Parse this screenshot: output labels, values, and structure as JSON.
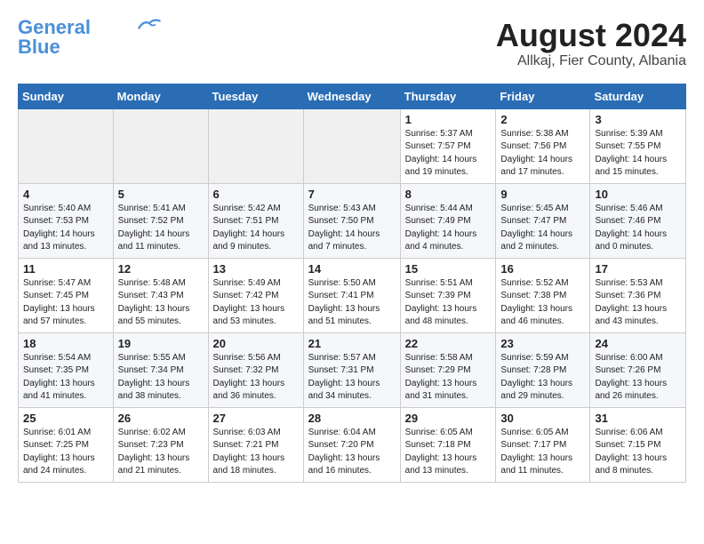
{
  "header": {
    "logo_line1": "General",
    "logo_line2": "Blue",
    "month": "August 2024",
    "location": "Allkaj, Fier County, Albania"
  },
  "weekdays": [
    "Sunday",
    "Monday",
    "Tuesday",
    "Wednesday",
    "Thursday",
    "Friday",
    "Saturday"
  ],
  "weeks": [
    [
      {
        "day": "",
        "detail": ""
      },
      {
        "day": "",
        "detail": ""
      },
      {
        "day": "",
        "detail": ""
      },
      {
        "day": "",
        "detail": ""
      },
      {
        "day": "1",
        "detail": "Sunrise: 5:37 AM\nSunset: 7:57 PM\nDaylight: 14 hours\nand 19 minutes."
      },
      {
        "day": "2",
        "detail": "Sunrise: 5:38 AM\nSunset: 7:56 PM\nDaylight: 14 hours\nand 17 minutes."
      },
      {
        "day": "3",
        "detail": "Sunrise: 5:39 AM\nSunset: 7:55 PM\nDaylight: 14 hours\nand 15 minutes."
      }
    ],
    [
      {
        "day": "4",
        "detail": "Sunrise: 5:40 AM\nSunset: 7:53 PM\nDaylight: 14 hours\nand 13 minutes."
      },
      {
        "day": "5",
        "detail": "Sunrise: 5:41 AM\nSunset: 7:52 PM\nDaylight: 14 hours\nand 11 minutes."
      },
      {
        "day": "6",
        "detail": "Sunrise: 5:42 AM\nSunset: 7:51 PM\nDaylight: 14 hours\nand 9 minutes."
      },
      {
        "day": "7",
        "detail": "Sunrise: 5:43 AM\nSunset: 7:50 PM\nDaylight: 14 hours\nand 7 minutes."
      },
      {
        "day": "8",
        "detail": "Sunrise: 5:44 AM\nSunset: 7:49 PM\nDaylight: 14 hours\nand 4 minutes."
      },
      {
        "day": "9",
        "detail": "Sunrise: 5:45 AM\nSunset: 7:47 PM\nDaylight: 14 hours\nand 2 minutes."
      },
      {
        "day": "10",
        "detail": "Sunrise: 5:46 AM\nSunset: 7:46 PM\nDaylight: 14 hours\nand 0 minutes."
      }
    ],
    [
      {
        "day": "11",
        "detail": "Sunrise: 5:47 AM\nSunset: 7:45 PM\nDaylight: 13 hours\nand 57 minutes."
      },
      {
        "day": "12",
        "detail": "Sunrise: 5:48 AM\nSunset: 7:43 PM\nDaylight: 13 hours\nand 55 minutes."
      },
      {
        "day": "13",
        "detail": "Sunrise: 5:49 AM\nSunset: 7:42 PM\nDaylight: 13 hours\nand 53 minutes."
      },
      {
        "day": "14",
        "detail": "Sunrise: 5:50 AM\nSunset: 7:41 PM\nDaylight: 13 hours\nand 51 minutes."
      },
      {
        "day": "15",
        "detail": "Sunrise: 5:51 AM\nSunset: 7:39 PM\nDaylight: 13 hours\nand 48 minutes."
      },
      {
        "day": "16",
        "detail": "Sunrise: 5:52 AM\nSunset: 7:38 PM\nDaylight: 13 hours\nand 46 minutes."
      },
      {
        "day": "17",
        "detail": "Sunrise: 5:53 AM\nSunset: 7:36 PM\nDaylight: 13 hours\nand 43 minutes."
      }
    ],
    [
      {
        "day": "18",
        "detail": "Sunrise: 5:54 AM\nSunset: 7:35 PM\nDaylight: 13 hours\nand 41 minutes."
      },
      {
        "day": "19",
        "detail": "Sunrise: 5:55 AM\nSunset: 7:34 PM\nDaylight: 13 hours\nand 38 minutes."
      },
      {
        "day": "20",
        "detail": "Sunrise: 5:56 AM\nSunset: 7:32 PM\nDaylight: 13 hours\nand 36 minutes."
      },
      {
        "day": "21",
        "detail": "Sunrise: 5:57 AM\nSunset: 7:31 PM\nDaylight: 13 hours\nand 34 minutes."
      },
      {
        "day": "22",
        "detail": "Sunrise: 5:58 AM\nSunset: 7:29 PM\nDaylight: 13 hours\nand 31 minutes."
      },
      {
        "day": "23",
        "detail": "Sunrise: 5:59 AM\nSunset: 7:28 PM\nDaylight: 13 hours\nand 29 minutes."
      },
      {
        "day": "24",
        "detail": "Sunrise: 6:00 AM\nSunset: 7:26 PM\nDaylight: 13 hours\nand 26 minutes."
      }
    ],
    [
      {
        "day": "25",
        "detail": "Sunrise: 6:01 AM\nSunset: 7:25 PM\nDaylight: 13 hours\nand 24 minutes."
      },
      {
        "day": "26",
        "detail": "Sunrise: 6:02 AM\nSunset: 7:23 PM\nDaylight: 13 hours\nand 21 minutes."
      },
      {
        "day": "27",
        "detail": "Sunrise: 6:03 AM\nSunset: 7:21 PM\nDaylight: 13 hours\nand 18 minutes."
      },
      {
        "day": "28",
        "detail": "Sunrise: 6:04 AM\nSunset: 7:20 PM\nDaylight: 13 hours\nand 16 minutes."
      },
      {
        "day": "29",
        "detail": "Sunrise: 6:05 AM\nSunset: 7:18 PM\nDaylight: 13 hours\nand 13 minutes."
      },
      {
        "day": "30",
        "detail": "Sunrise: 6:05 AM\nSunset: 7:17 PM\nDaylight: 13 hours\nand 11 minutes."
      },
      {
        "day": "31",
        "detail": "Sunrise: 6:06 AM\nSunset: 7:15 PM\nDaylight: 13 hours\nand 8 minutes."
      }
    ]
  ]
}
